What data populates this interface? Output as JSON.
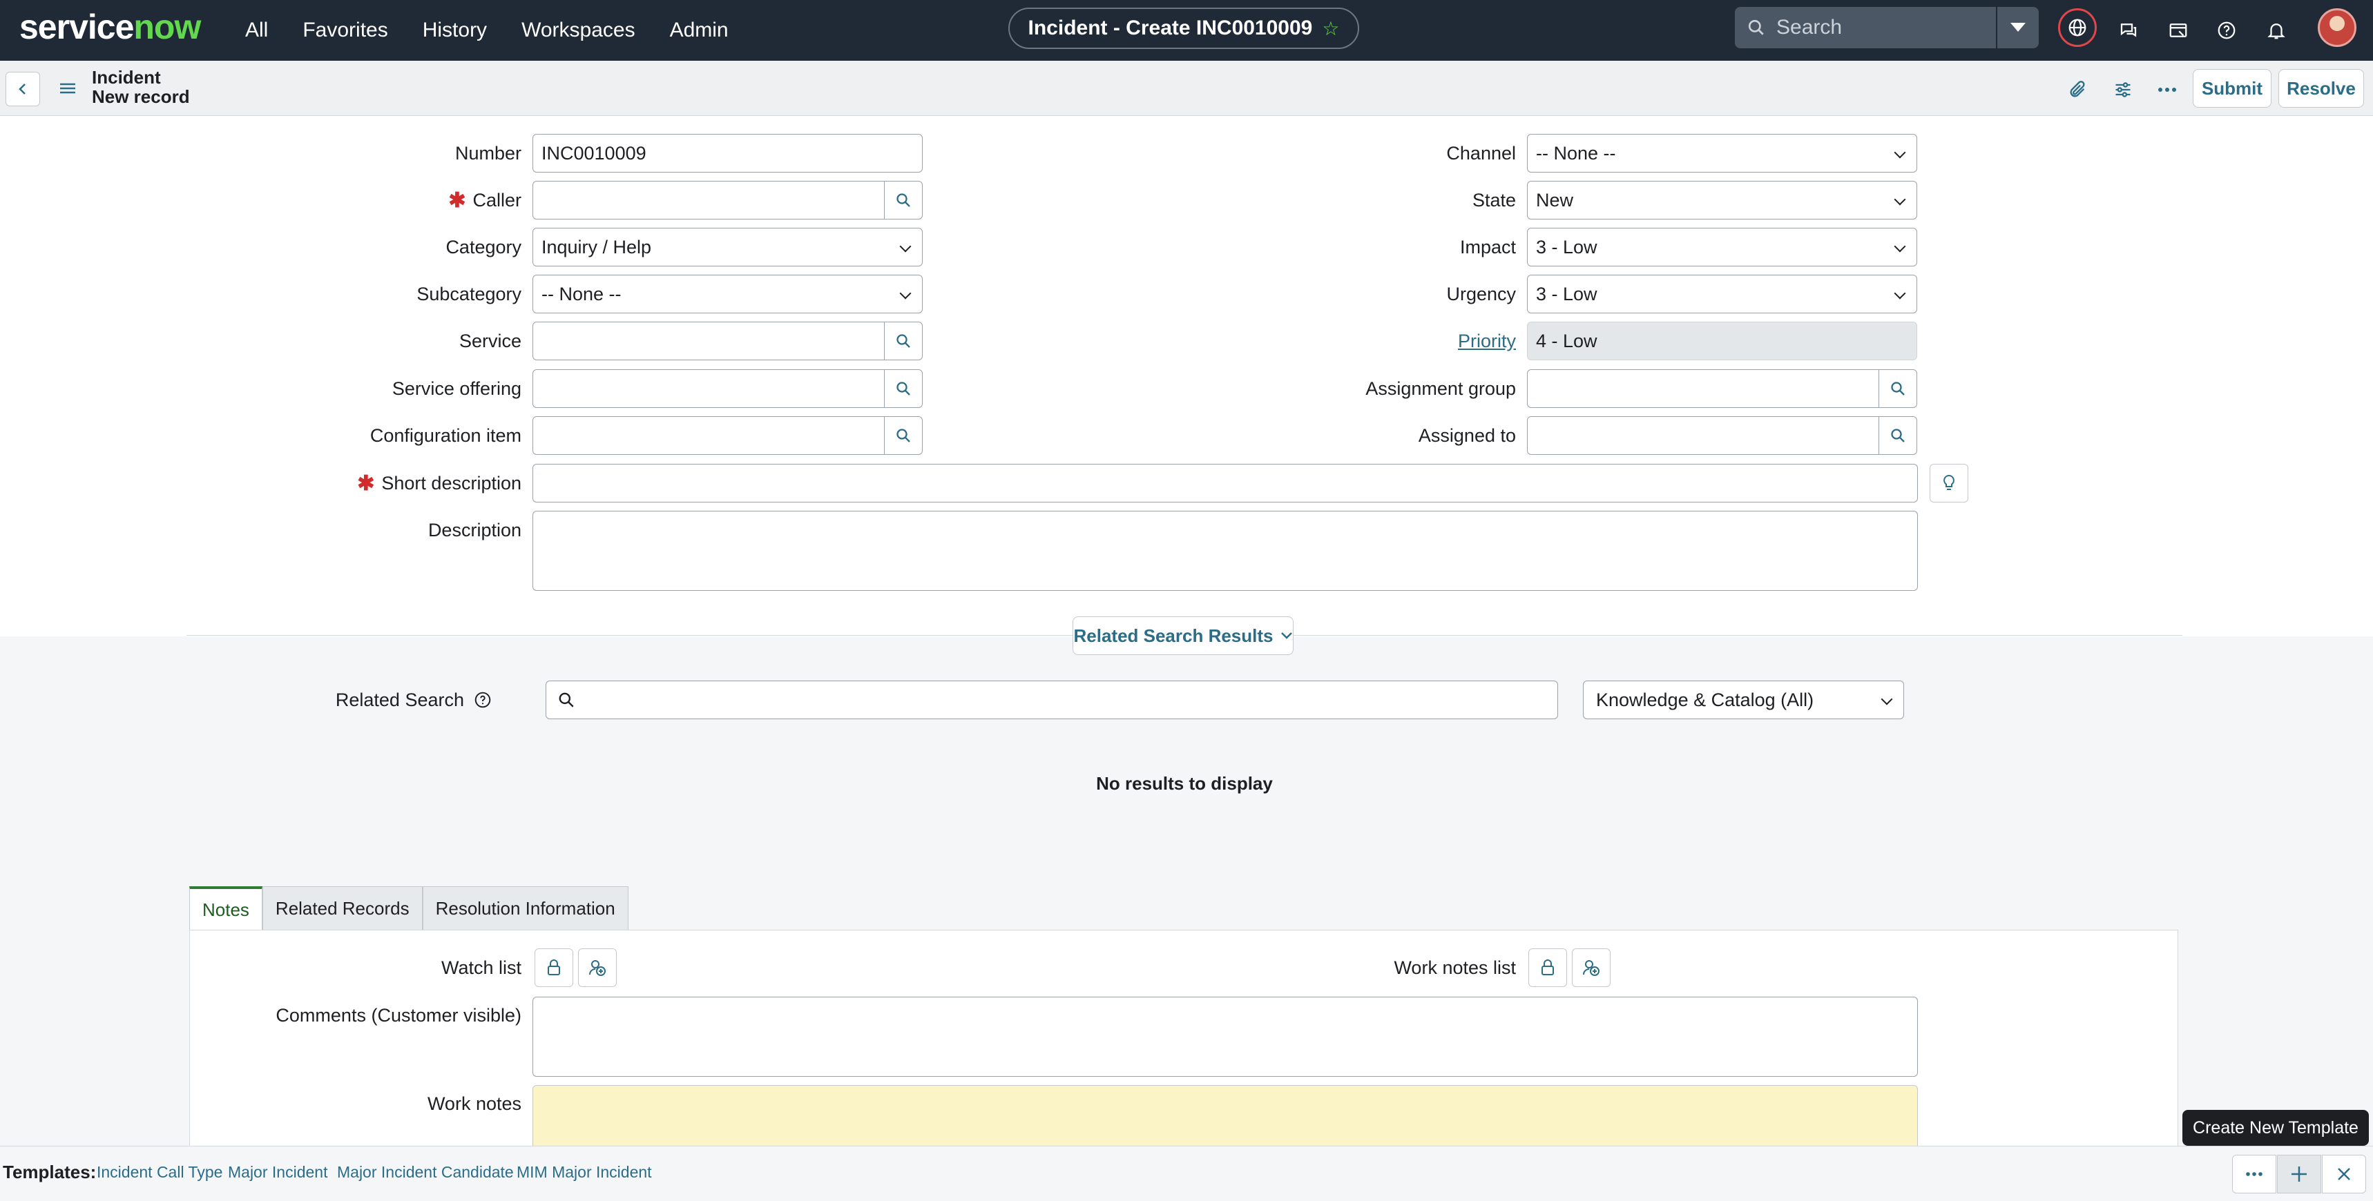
{
  "app": {
    "logo_service": "service",
    "logo_now": "now",
    "menu": [
      "All",
      "Favorites",
      "History",
      "Workspaces",
      "Admin"
    ],
    "context_title": "Incident - Create INC0010009",
    "search_placeholder": "Search"
  },
  "record": {
    "table": "Incident",
    "subtitle": "New record",
    "submit_label": "Submit",
    "resolve_label": "Resolve"
  },
  "form": {
    "number_label": "Number",
    "number_value": "INC0010009",
    "caller_label": "Caller",
    "category_label": "Category",
    "category_value": "Inquiry / Help",
    "subcategory_label": "Subcategory",
    "subcategory_value": "-- None --",
    "service_label": "Service",
    "service_offering_label": "Service offering",
    "ci_label": "Configuration item",
    "short_desc_label": "Short description",
    "description_label": "Description",
    "channel_label": "Channel",
    "channel_value": "-- None --",
    "state_label": "State",
    "state_value": "New",
    "impact_label": "Impact",
    "impact_value": "3 - Low",
    "urgency_label": "Urgency",
    "urgency_value": "3 - Low",
    "priority_label": "Priority",
    "priority_value": "4 - Low",
    "assignment_group_label": "Assignment group",
    "assigned_to_label": "Assigned to"
  },
  "related": {
    "toggle_label": "Related Search Results",
    "search_label": "Related Search",
    "source_value": "Knowledge & Catalog (All)",
    "no_results": "No results to display"
  },
  "tabs": [
    "Notes",
    "Related Records",
    "Resolution Information"
  ],
  "notes": {
    "watch_list_label": "Watch list",
    "work_notes_list_label": "Work notes list",
    "comments_label": "Comments (Customer visible)",
    "work_notes_label": "Work notes"
  },
  "templates": {
    "label": "Templates:",
    "items": [
      "Incident Call Type",
      "Major Incident",
      "Major Incident Candidate",
      "MIM Major Incident"
    ],
    "tooltip": "Create New Template"
  },
  "colors": {
    "nav_bg": "#1f2a36",
    "brand_green": "#62d84e",
    "link": "#2b6c87",
    "required": "#d12c2c",
    "work_notes_bg": "#fbf4c6"
  }
}
